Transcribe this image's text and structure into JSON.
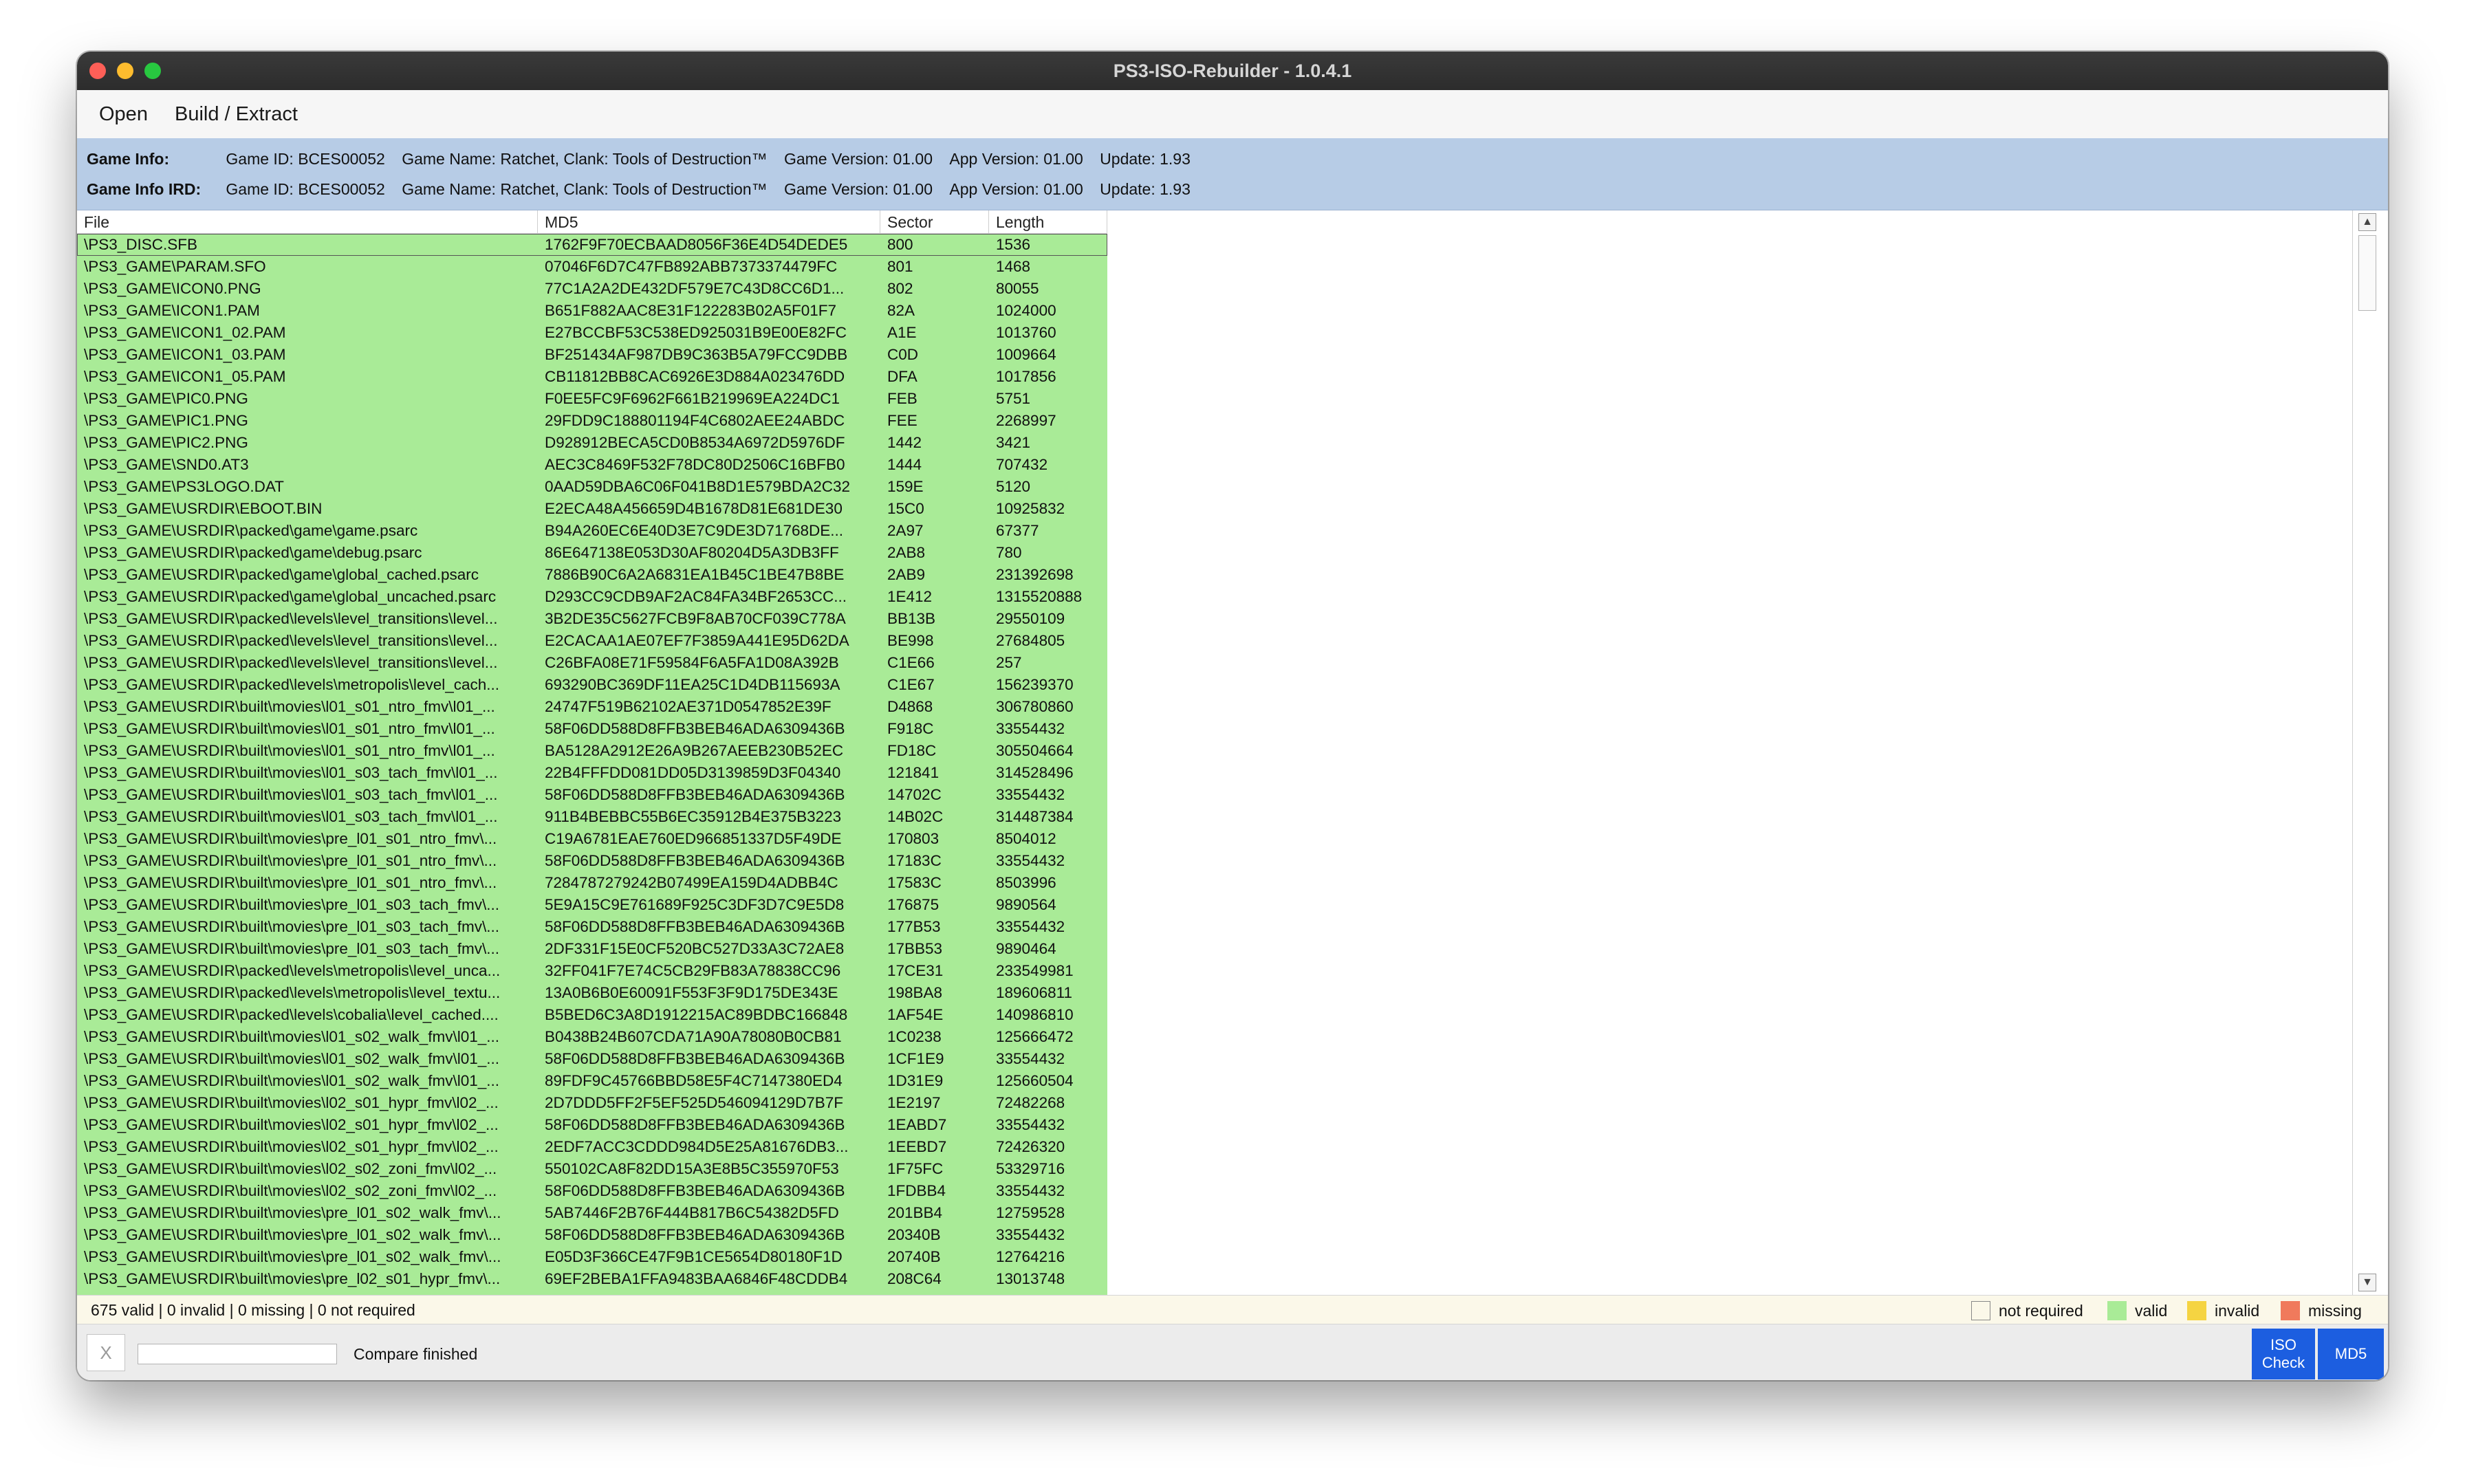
{
  "window": {
    "title": "PS3-ISO-Rebuilder - 1.0.4.1"
  },
  "menu": {
    "open": "Open",
    "build_extract": "Build / Extract"
  },
  "game_info": {
    "label": "Game Info:",
    "game_id": "Game ID: BCES00052",
    "game_name": "Game Name: Ratchet, Clank: Tools of Destruction™",
    "game_version": "Game Version: 01.00",
    "app_version": "App Version: 01.00",
    "update": "Update: 1.93"
  },
  "game_info_ird": {
    "label": "Game Info IRD:",
    "game_id": "Game ID: BCES00052",
    "game_name": "Game Name: Ratchet, Clank: Tools of Destruction™",
    "game_version": "Game Version: 01.00",
    "app_version": "App Version: 01.00",
    "update": "Update: 1.93"
  },
  "table": {
    "columns": [
      "File",
      "MD5",
      "Sector",
      "Length"
    ],
    "rows": [
      [
        "\\PS3_DISC.SFB",
        "1762F9F70ECBAAD8056F36E4D54DEDE5",
        "800",
        "1536"
      ],
      [
        "\\PS3_GAME\\PARAM.SFO",
        "07046F6D7C47FB892ABB7373374479FC",
        "801",
        "1468"
      ],
      [
        "\\PS3_GAME\\ICON0.PNG",
        "77C1A2A2DE432DF579E7C43D8CC6D1...",
        "802",
        "80055"
      ],
      [
        "\\PS3_GAME\\ICON1.PAM",
        "B651F882AAC8E31F122283B02A5F01F7",
        "82A",
        "1024000"
      ],
      [
        "\\PS3_GAME\\ICON1_02.PAM",
        "E27BCCBF53C538ED925031B9E00E82FC",
        "A1E",
        "1013760"
      ],
      [
        "\\PS3_GAME\\ICON1_03.PAM",
        "BF251434AF987DB9C363B5A79FCC9DBB",
        "C0D",
        "1009664"
      ],
      [
        "\\PS3_GAME\\ICON1_05.PAM",
        "CB11812BB8CAC6926E3D884A023476DD",
        "DFA",
        "1017856"
      ],
      [
        "\\PS3_GAME\\PIC0.PNG",
        "F0EE5FC9F6962F661B219969EA224DC1",
        "FEB",
        "5751"
      ],
      [
        "\\PS3_GAME\\PIC1.PNG",
        "29FDD9C188801194F4C6802AEE24ABDC",
        "FEE",
        "2268997"
      ],
      [
        "\\PS3_GAME\\PIC2.PNG",
        "D928912BECA5CD0B8534A6972D5976DF",
        "1442",
        "3421"
      ],
      [
        "\\PS3_GAME\\SND0.AT3",
        "AEC3C8469F532F78DC80D2506C16BFB0",
        "1444",
        "707432"
      ],
      [
        "\\PS3_GAME\\PS3LOGO.DAT",
        "0AAD59DBA6C06F041B8D1E579BDA2C32",
        "159E",
        "5120"
      ],
      [
        "\\PS3_GAME\\USRDIR\\EBOOT.BIN",
        "E2ECA48A456659D4B1678D81E681DE30",
        "15C0",
        "10925832"
      ],
      [
        "\\PS3_GAME\\USRDIR\\packed\\game\\game.psarc",
        "B94A260EC6E40D3E7C9DE3D71768DE...",
        "2A97",
        "67377"
      ],
      [
        "\\PS3_GAME\\USRDIR\\packed\\game\\debug.psarc",
        "86E647138E053D30AF80204D5A3DB3FF",
        "2AB8",
        "780"
      ],
      [
        "\\PS3_GAME\\USRDIR\\packed\\game\\global_cached.psarc",
        "7886B90C6A2A6831EA1B45C1BE47B8BE",
        "2AB9",
        "231392698"
      ],
      [
        "\\PS3_GAME\\USRDIR\\packed\\game\\global_uncached.psarc",
        "D293CC9CDB9AF2AC84FA34BF2653CC...",
        "1E412",
        "1315520888"
      ],
      [
        "\\PS3_GAME\\USRDIR\\packed\\levels\\level_transitions\\level...",
        "3B2DE35C5627FCB9F8AB70CF039C778A",
        "BB13B",
        "29550109"
      ],
      [
        "\\PS3_GAME\\USRDIR\\packed\\levels\\level_transitions\\level...",
        "E2CACAA1AE07EF7F3859A441E95D62DA",
        "BE998",
        "27684805"
      ],
      [
        "\\PS3_GAME\\USRDIR\\packed\\levels\\level_transitions\\level...",
        "C26BFA08E71F59584F6A5FA1D08A392B",
        "C1E66",
        "257"
      ],
      [
        "\\PS3_GAME\\USRDIR\\packed\\levels\\metropolis\\level_cach...",
        "693290BC369DF11EA25C1D4DB115693A",
        "C1E67",
        "156239370"
      ],
      [
        "\\PS3_GAME\\USRDIR\\built\\movies\\l01_s01_ntro_fmv\\l01_...",
        "24747F519B62102AE371D0547852E39F",
        "D4868",
        "306780860"
      ],
      [
        "\\PS3_GAME\\USRDIR\\built\\movies\\l01_s01_ntro_fmv\\l01_...",
        "58F06DD588D8FFB3BEB46ADA6309436B",
        "F918C",
        "33554432"
      ],
      [
        "\\PS3_GAME\\USRDIR\\built\\movies\\l01_s01_ntro_fmv\\l01_...",
        "BA5128A2912E26A9B267AEEB230B52EC",
        "FD18C",
        "305504664"
      ],
      [
        "\\PS3_GAME\\USRDIR\\built\\movies\\l01_s03_tach_fmv\\l01_...",
        "22B4FFFDD081DD05D3139859D3F04340",
        "121841",
        "314528496"
      ],
      [
        "\\PS3_GAME\\USRDIR\\built\\movies\\l01_s03_tach_fmv\\l01_...",
        "58F06DD588D8FFB3BEB46ADA6309436B",
        "14702C",
        "33554432"
      ],
      [
        "\\PS3_GAME\\USRDIR\\built\\movies\\l01_s03_tach_fmv\\l01_...",
        "911B4BEBBC55B6EC35912B4E375B3223",
        "14B02C",
        "314487384"
      ],
      [
        "\\PS3_GAME\\USRDIR\\built\\movies\\pre_l01_s01_ntro_fmv\\...",
        "C19A6781EAE760ED966851337D5F49DE",
        "170803",
        "8504012"
      ],
      [
        "\\PS3_GAME\\USRDIR\\built\\movies\\pre_l01_s01_ntro_fmv\\...",
        "58F06DD588D8FFB3BEB46ADA6309436B",
        "17183C",
        "33554432"
      ],
      [
        "\\PS3_GAME\\USRDIR\\built\\movies\\pre_l01_s01_ntro_fmv\\...",
        "7284787279242B07499EA159D4ADBB4C",
        "17583C",
        "8503996"
      ],
      [
        "\\PS3_GAME\\USRDIR\\built\\movies\\pre_l01_s03_tach_fmv\\...",
        "5E9A15C9E761689F925C3DF3D7C9E5D8",
        "176875",
        "9890564"
      ],
      [
        "\\PS3_GAME\\USRDIR\\built\\movies\\pre_l01_s03_tach_fmv\\...",
        "58F06DD588D8FFB3BEB46ADA6309436B",
        "177B53",
        "33554432"
      ],
      [
        "\\PS3_GAME\\USRDIR\\built\\movies\\pre_l01_s03_tach_fmv\\...",
        "2DF331F15E0CF520BC527D33A3C72AE8",
        "17BB53",
        "9890464"
      ],
      [
        "\\PS3_GAME\\USRDIR\\packed\\levels\\metropolis\\level_unca...",
        "32FF041F7E74C5CB29FB83A78838CC96",
        "17CE31",
        "233549981"
      ],
      [
        "\\PS3_GAME\\USRDIR\\packed\\levels\\metropolis\\level_textu...",
        "13A0B6B0E60091F553F3F9D175DE343E",
        "198BA8",
        "189606811"
      ],
      [
        "\\PS3_GAME\\USRDIR\\packed\\levels\\cobalia\\level_cached....",
        "B5BED6C3A8D1912215AC89BDBC166848",
        "1AF54E",
        "140986810"
      ],
      [
        "\\PS3_GAME\\USRDIR\\built\\movies\\l01_s02_walk_fmv\\l01_...",
        "B0438B24B607CDA71A90A78080B0CB81",
        "1C0238",
        "125666472"
      ],
      [
        "\\PS3_GAME\\USRDIR\\built\\movies\\l01_s02_walk_fmv\\l01_...",
        "58F06DD588D8FFB3BEB46ADA6309436B",
        "1CF1E9",
        "33554432"
      ],
      [
        "\\PS3_GAME\\USRDIR\\built\\movies\\l01_s02_walk_fmv\\l01_...",
        "89FDF9C45766BBD58E5F4C7147380ED4",
        "1D31E9",
        "125660504"
      ],
      [
        "\\PS3_GAME\\USRDIR\\built\\movies\\l02_s01_hypr_fmv\\l02_...",
        "2D7DDD5FF2F5EF525D546094129D7B7F",
        "1E2197",
        "72482268"
      ],
      [
        "\\PS3_GAME\\USRDIR\\built\\movies\\l02_s01_hypr_fmv\\l02_...",
        "58F06DD588D8FFB3BEB46ADA6309436B",
        "1EABD7",
        "33554432"
      ],
      [
        "\\PS3_GAME\\USRDIR\\built\\movies\\l02_s01_hypr_fmv\\l02_...",
        "2EDF7ACC3CDDD984D5E25A81676DB3...",
        "1EEBD7",
        "72426320"
      ],
      [
        "\\PS3_GAME\\USRDIR\\built\\movies\\l02_s02_zoni_fmv\\l02_...",
        "550102CA8F82DD15A3E8B5C355970F53",
        "1F75FC",
        "53329716"
      ],
      [
        "\\PS3_GAME\\USRDIR\\built\\movies\\l02_s02_zoni_fmv\\l02_...",
        "58F06DD588D8FFB3BEB46ADA6309436B",
        "1FDBB4",
        "33554432"
      ],
      [
        "\\PS3_GAME\\USRDIR\\built\\movies\\pre_l01_s02_walk_fmv\\...",
        "5AB7446F2B76F444B817B6C54382D5FD",
        "201BB4",
        "12759528"
      ],
      [
        "\\PS3_GAME\\USRDIR\\built\\movies\\pre_l01_s02_walk_fmv\\...",
        "58F06DD588D8FFB3BEB46ADA6309436B",
        "20340B",
        "33554432"
      ],
      [
        "\\PS3_GAME\\USRDIR\\built\\movies\\pre_l01_s02_walk_fmv\\...",
        "E05D3F366CE47F9B1CE5654D80180F1D",
        "20740B",
        "12764216"
      ],
      [
        "\\PS3_GAME\\USRDIR\\built\\movies\\pre_l02_s01_hypr_fmv\\...",
        "69EF2BEBA1FFA9483BAA6846F48CDDB4",
        "208C64",
        "13013748"
      ]
    ]
  },
  "status": {
    "summary": "675 valid | 0 invalid | 0 missing | 0 not required",
    "legend": {
      "not_required": "not required",
      "valid": "valid",
      "invalid": "invalid",
      "missing": "missing"
    },
    "colors": {
      "not_required": "#ffffff",
      "valid": "#a9eb97",
      "invalid": "#f5d442",
      "missing": "#f07a5c",
      "accent": "#1c5ee0"
    }
  },
  "bottom": {
    "cancel": "X",
    "compare_text": "Compare finished",
    "iso_check_line1": "ISO",
    "iso_check_line2": "Check",
    "md5": "MD5"
  }
}
